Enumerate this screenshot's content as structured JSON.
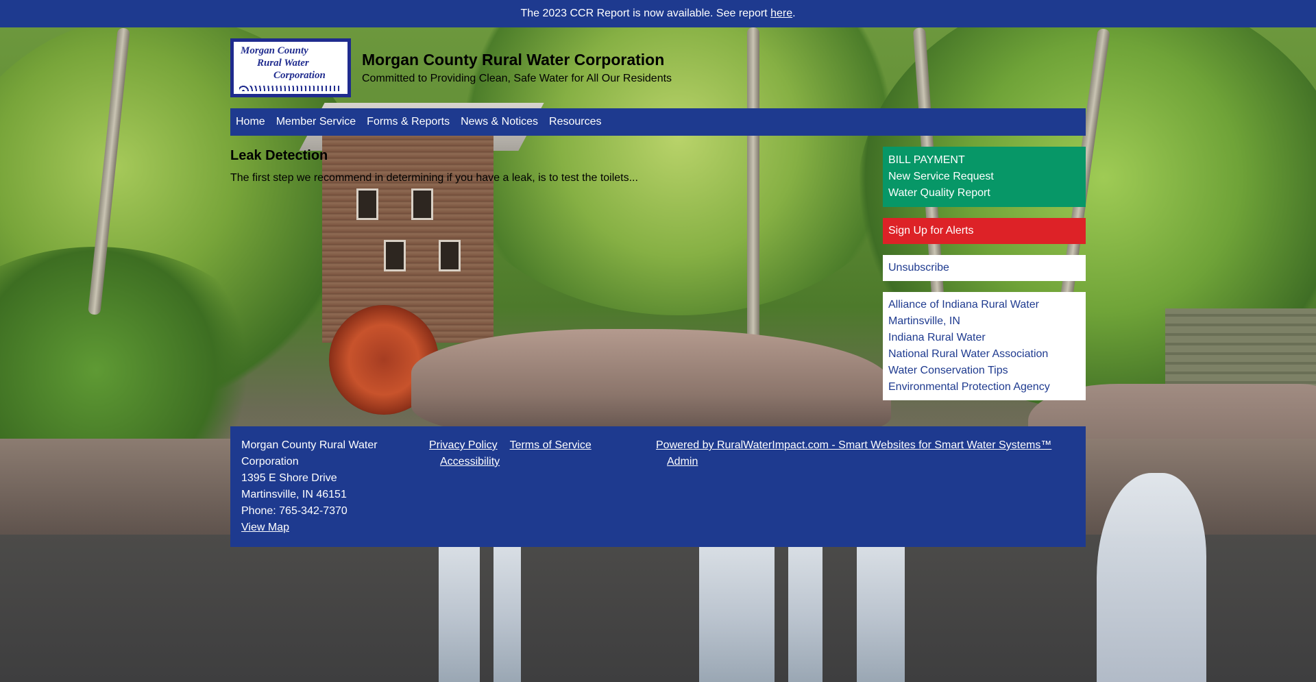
{
  "notice": {
    "text": "The 2023 CCR Report is now available. See report ",
    "link_label": "here",
    "suffix": "."
  },
  "header": {
    "logo_lines": [
      "Morgan County",
      "Rural Water",
      "Corporation"
    ],
    "title": "Morgan County Rural Water Corporation",
    "tagline": "Committed to Providing Clean, Safe Water for All Our Residents"
  },
  "nav": {
    "items": [
      {
        "label": "Home"
      },
      {
        "label": "Member Service"
      },
      {
        "label": "Forms & Reports"
      },
      {
        "label": "News & Notices"
      },
      {
        "label": "Resources"
      }
    ]
  },
  "main": {
    "heading": "Leak Detection",
    "text": "The first step we recommend in determining if you have a leak, is to test the toilets..."
  },
  "sidebar": {
    "green_links": [
      "BILL PAYMENT",
      "New Service Request",
      "Water Quality Report"
    ],
    "alert_link": "Sign Up for Alerts",
    "unsubscribe_link": "Unsubscribe",
    "resource_links": [
      "Alliance of Indiana Rural Water",
      "Martinsville, IN",
      "Indiana Rural Water",
      "National Rural Water Association",
      "Water Conservation Tips",
      "Environmental Protection Agency"
    ]
  },
  "footer": {
    "org_name": "Morgan County Rural Water Corporation",
    "address_line1": "1395 E Shore Drive",
    "address_line2": "Martinsville, IN 46151",
    "phone": "Phone: 765-342-7370",
    "map_link": "View Map",
    "privacy": "Privacy Policy",
    "terms": "Terms of Service",
    "accessibility": "Accessibility",
    "powered_by": "Powered by RuralWaterImpact.com - Smart Websites for Smart Water Systems™",
    "admin": "Admin"
  },
  "colors": {
    "brand_blue": "#1e3a8f",
    "green_box": "#079767",
    "red_box": "#dd2227"
  }
}
